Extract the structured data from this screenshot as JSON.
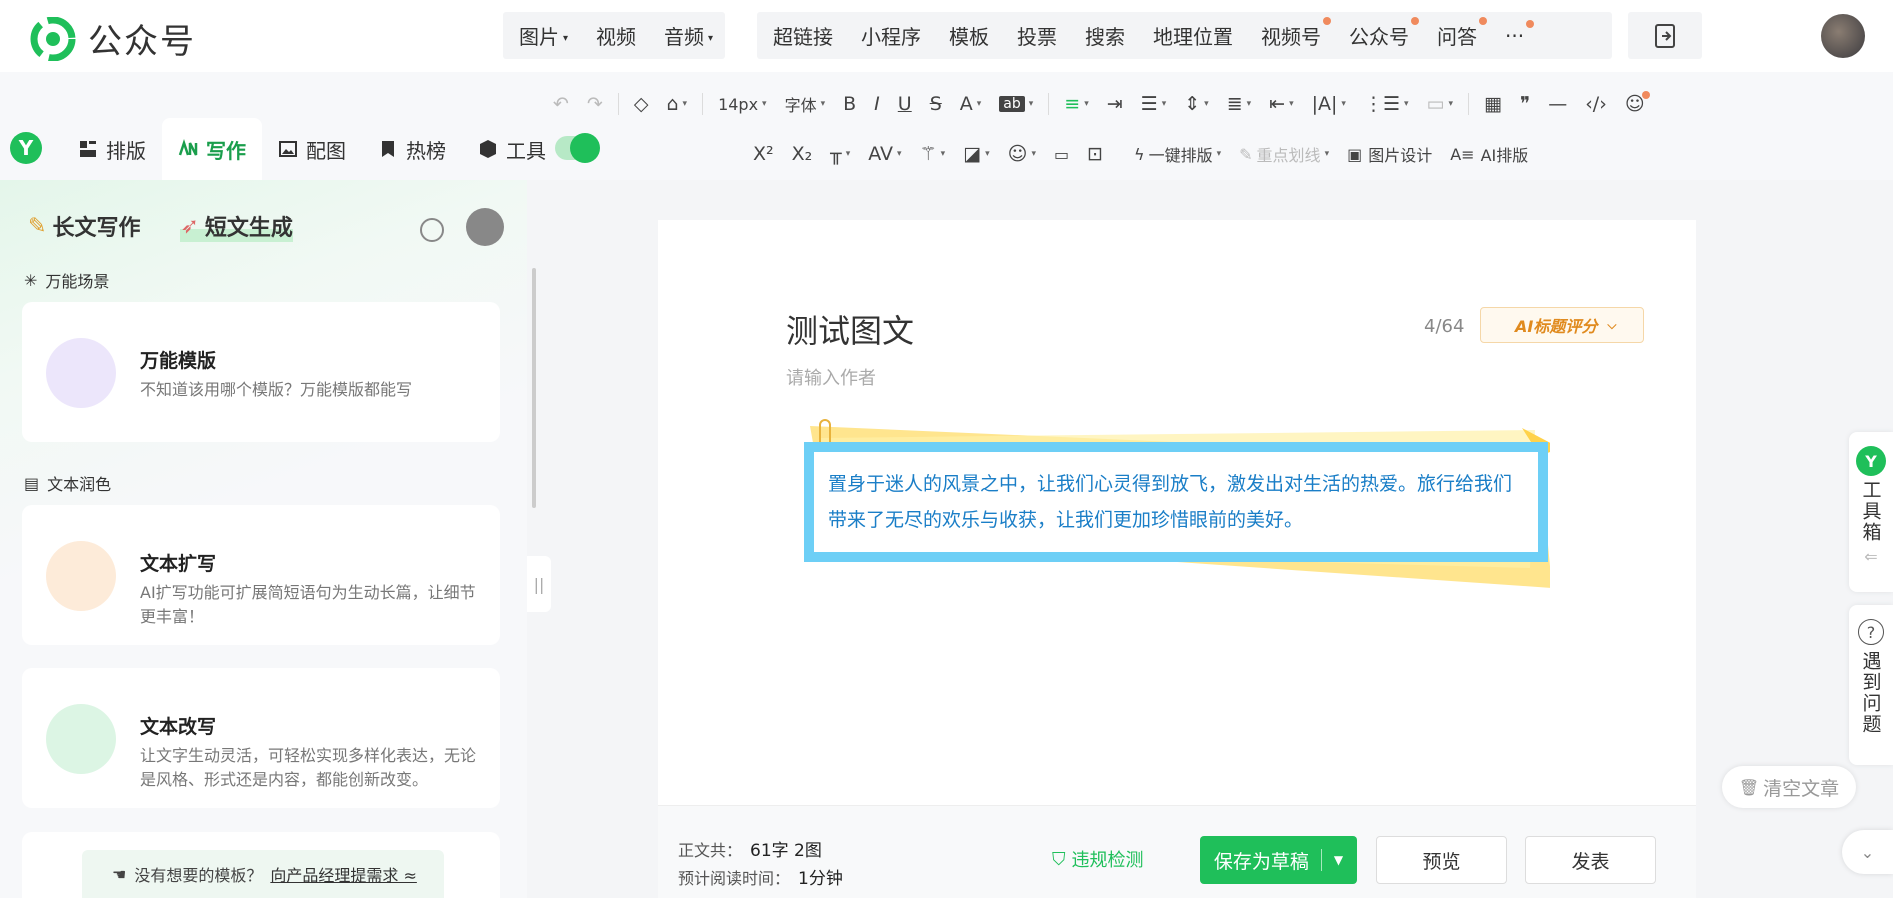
{
  "brand": {
    "name": "公众号"
  },
  "media_tabs": [
    {
      "label": "图片",
      "caret": "▾"
    },
    {
      "label": "视频",
      "caret": ""
    },
    {
      "label": "音频",
      "caret": "▾"
    }
  ],
  "insert_tabs": [
    {
      "label": "超链接"
    },
    {
      "label": "小程序"
    },
    {
      "label": "模板"
    },
    {
      "label": "投票"
    },
    {
      "label": "搜索"
    },
    {
      "label": "地理位置"
    },
    {
      "label": "视频号"
    },
    {
      "label": "公众号"
    },
    {
      "label": "问答"
    },
    {
      "label": "···"
    }
  ],
  "toolbar": {
    "font_size": "14px",
    "font_family": "字体",
    "bold": "B",
    "italic": "I",
    "underline": "U",
    "strike": "S",
    "font_color": "A",
    "highlight": "ab",
    "superscript": "X²",
    "subscript": "X₂",
    "one_click_layout": "一键排版",
    "key_underline": "重点划线",
    "image_design": "图片设计",
    "ai_layout": "AI排版"
  },
  "nav_tabs": [
    {
      "label": "排版"
    },
    {
      "label": "写作"
    },
    {
      "label": "配图"
    },
    {
      "label": "热榜"
    },
    {
      "label": "工具"
    }
  ],
  "left_panel": {
    "tab_long": "长文写作",
    "tab_short": "短文生成",
    "section_scene": "万能场景",
    "section_polish": "文本润色",
    "cards": [
      {
        "title": "万能模版",
        "desc": "不知道该用哪个模版？万能模版都能写"
      },
      {
        "title": "文本扩写",
        "desc": "AI扩写功能可扩展简短语句为生动长篇，让细节更丰富！"
      },
      {
        "title": "文本改写",
        "desc": "让文字生动灵活，可轻松实现多样化表达，无论是风格、形式还是内容，都能创新改变。"
      }
    ],
    "hint_text": "没有想要的模板？",
    "hint_link": "向产品经理提需求 ≈"
  },
  "editor": {
    "title": "测试图文",
    "title_count": "4/64",
    "ai_title_score": "AI标题评分",
    "author_placeholder": "请输入作者",
    "note_text": "置身于迷人的风景之中，让我们心灵得到放飞，激发出对生活的热爱。旅行给我们带来了无尽的欢乐与收获，让我们更加珍惜眼前的美好。"
  },
  "footer": {
    "body_label": "正文共：",
    "body_value": "61字 2图",
    "read_label": "预计阅读时间：",
    "read_value": "1分钟",
    "check": "违规检测",
    "save": "保存为草稿",
    "preview": "预览",
    "publish": "发表"
  },
  "side": {
    "toolbox": "工具箱",
    "problem": "遇到问题",
    "clear": "清空文章"
  },
  "colors": {
    "brand_green": "#1fbf5a",
    "note_border": "#6dcff6",
    "note_text": "#1a7ec7"
  }
}
